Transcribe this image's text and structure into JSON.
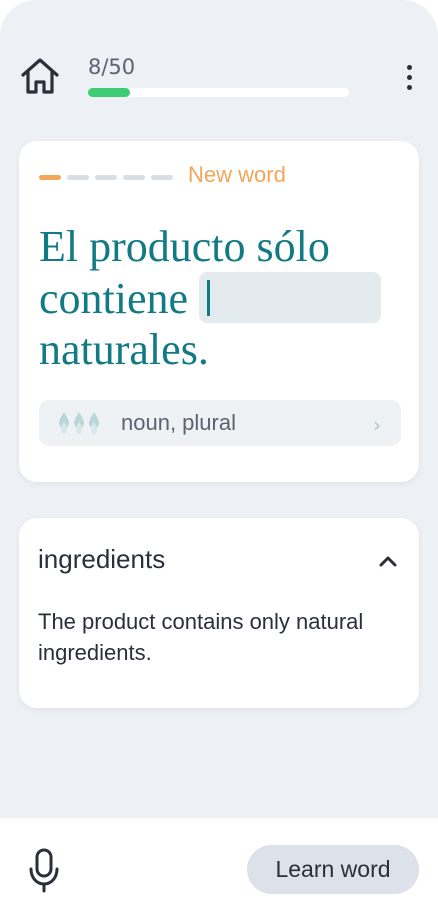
{
  "header": {
    "home_icon": "home-icon",
    "progress_text": "8/50",
    "progress_fraction": 0.16,
    "menu_icon": "more-vertical-icon"
  },
  "word_card": {
    "status": "New word",
    "dashes_total": 5,
    "dashes_active": 1,
    "sentence_before": "El producto sólo contiene",
    "sentence_after": "naturales.",
    "part_of_speech": "noun, plural",
    "chevron": "›"
  },
  "translation": {
    "word": "ingredients",
    "sentence": "The product contains only natural ingredients."
  },
  "footer": {
    "mic_icon": "microphone-icon",
    "learn_label": "Learn word"
  },
  "colors": {
    "accent_teal": "#117a85",
    "new_word_orange": "#f3a65a",
    "progress_green": "#3ecc74",
    "background": "#edf0f4"
  }
}
